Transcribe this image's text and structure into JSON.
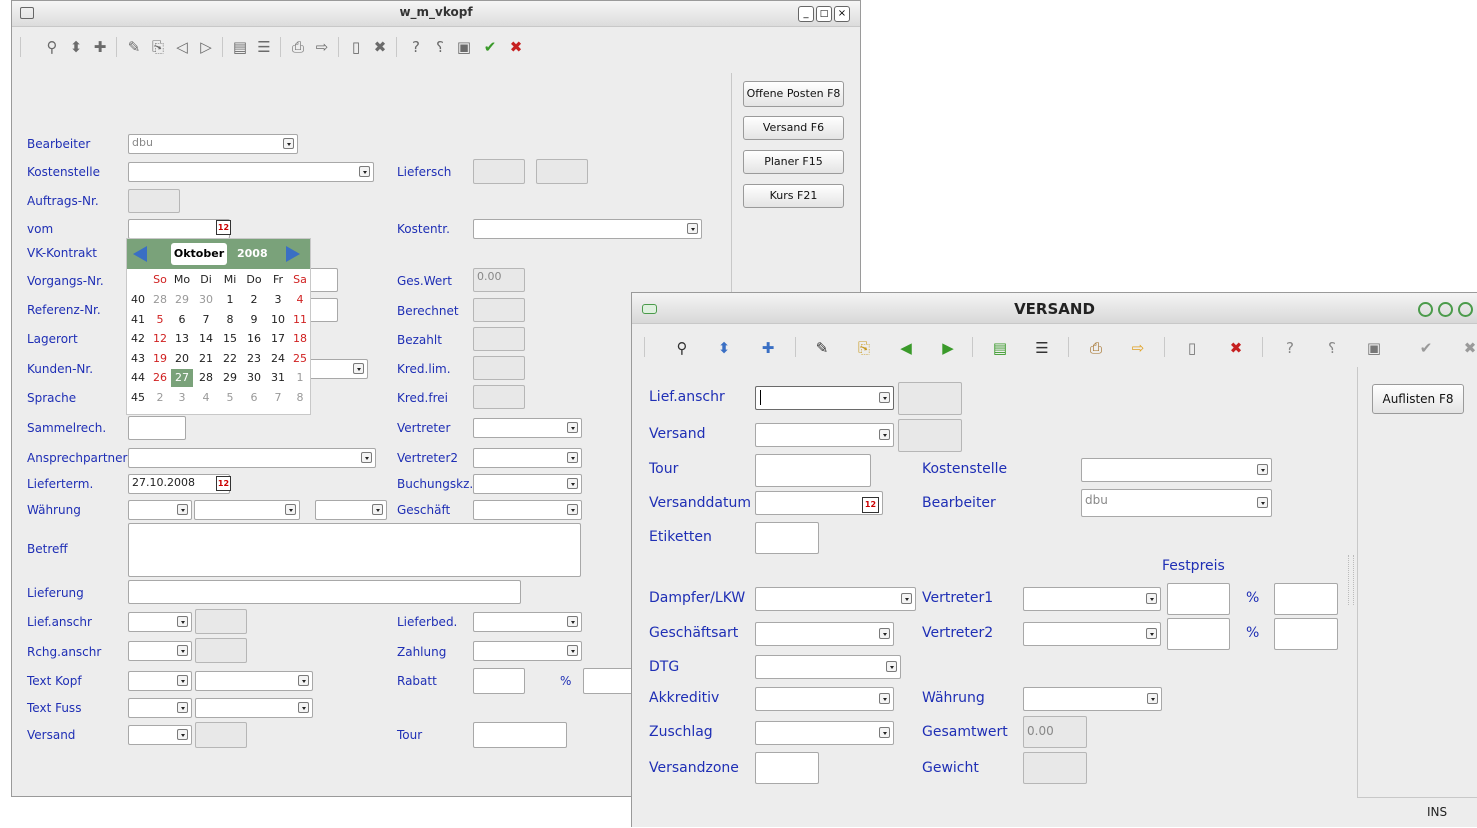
{
  "w1": {
    "title": "w_m_vkopf",
    "buttons": [
      "Offene Posten F8",
      "Versand F6",
      "Planer F15",
      "Kurs F21"
    ],
    "labels": {
      "bearbeiter": "Bearbeiter",
      "kostenstelle": "Kostenstelle",
      "auftrags_nr": "Auftrags-Nr.",
      "vom": "vom",
      "vk_kontrakt": "VK-Kontrakt",
      "vorgangs_nr": "Vorgangs-Nr.",
      "referenz_nr": "Referenz-Nr.",
      "lagerort": "Lagerort",
      "kunden_nr": "Kunden-Nr.",
      "sprache": "Sprache",
      "sammelrech": "Sammelrech.",
      "ansprechpartner": "Ansprechpartner",
      "lieferterm": "Lieferterm.",
      "waehrung": "Währung",
      "betreff": "Betreff",
      "lieferung": "Lieferung",
      "lief_anschr": "Lief.anschr",
      "rchg_anschr": "Rchg.anschr",
      "text_kopf": "Text Kopf",
      "text_fuss": "Text Fuss",
      "versand": "Versand",
      "liefersch": "Liefersch",
      "kostentr": "Kostentr.",
      "ges_wert": "Ges.Wert",
      "berechnet": "Berechnet",
      "bezahlt": "Bezahlt",
      "kred_lim": "Kred.lim.",
      "kred_frei": "Kred.frei",
      "vertreter": "Vertreter",
      "vertreter2": "Vertreter2",
      "buchungskz": "Buchungskz.",
      "geschaeft": "Geschäft",
      "lieferbed": "Lieferbed.",
      "zahlung": "Zahlung",
      "rabatt": "Rabatt",
      "pct": "%",
      "tour": "Tour"
    },
    "values": {
      "bearbeiter": "dbu",
      "lieferterm": "27.10.2008",
      "ges_wert": "0.00"
    },
    "calendar": {
      "month": "Oktober",
      "year": "2008",
      "weekdays": [
        "So",
        "Mo",
        "Di",
        "Mi",
        "Do",
        "Fr",
        "Sa"
      ],
      "weeks": [
        {
          "wk": "40",
          "days": [
            "28",
            "29",
            "30",
            "1",
            "2",
            "3",
            "4"
          ]
        },
        {
          "wk": "41",
          "days": [
            "5",
            "6",
            "7",
            "8",
            "9",
            "10",
            "11"
          ]
        },
        {
          "wk": "42",
          "days": [
            "12",
            "13",
            "14",
            "15",
            "16",
            "17",
            "18"
          ]
        },
        {
          "wk": "43",
          "days": [
            "19",
            "20",
            "21",
            "22",
            "23",
            "24",
            "25"
          ]
        },
        {
          "wk": "44",
          "days": [
            "26",
            "27",
            "28",
            "29",
            "30",
            "31",
            "1"
          ]
        },
        {
          "wk": "45",
          "days": [
            "2",
            "3",
            "4",
            "5",
            "6",
            "7",
            "8"
          ]
        }
      ],
      "selected": "27"
    }
  },
  "w2": {
    "title": "VERSAND",
    "button": "Auflisten F8",
    "status": "INS",
    "labels": {
      "lief_anschr": "Lief.anschr",
      "versand": "Versand",
      "tour": "Tour",
      "versanddatum": "Versanddatum",
      "etiketten": "Etiketten",
      "dampfer": "Dampfer/LKW",
      "geschaeftsart": "Geschäftsart",
      "dtg": "DTG",
      "akkreditiv": "Akkreditiv",
      "zuschlag": "Zuschlag",
      "versandzone": "Versandzone",
      "kostenstelle": "Kostenstelle",
      "bearbeiter": "Bearbeiter",
      "festpreis": "Festpreis",
      "vertreter1": "Vertreter1",
      "vertreter2": "Vertreter2",
      "waehrung": "Währung",
      "gesamtwert": "Gesamtwert",
      "gewicht": "Gewicht",
      "pct": "%"
    },
    "values": {
      "bearbeiter": "dbu",
      "gesamtwert": "0.00"
    }
  }
}
